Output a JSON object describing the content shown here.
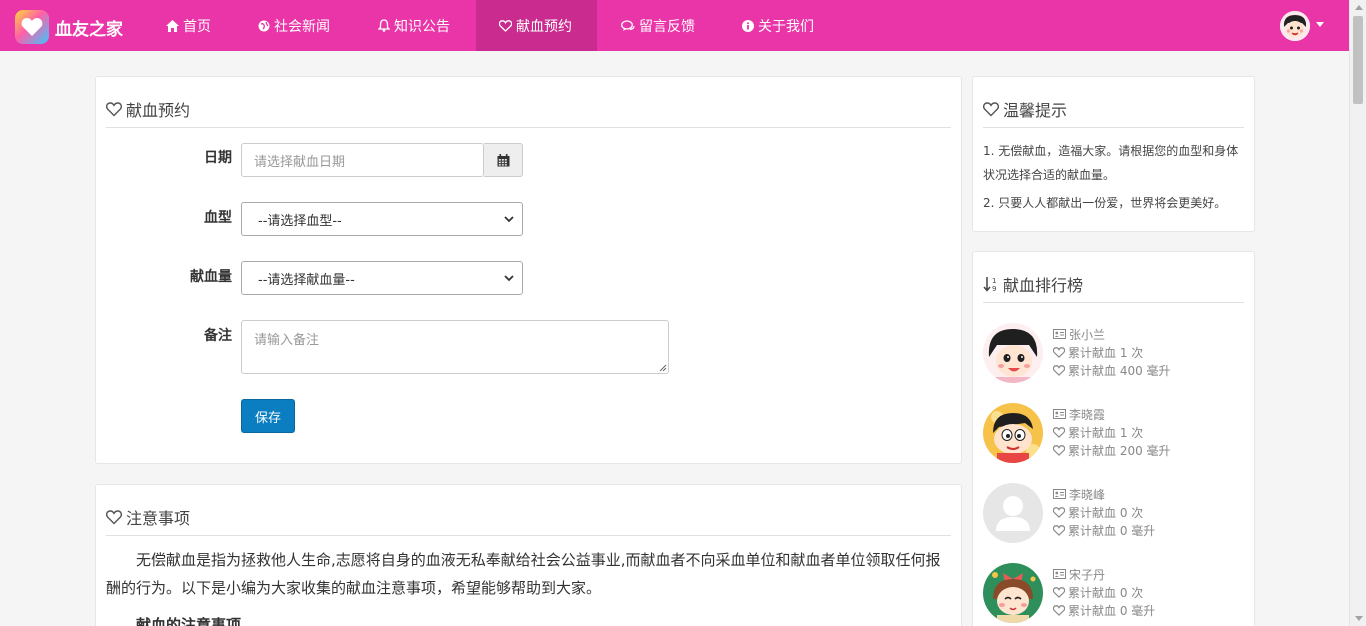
{
  "brand": {
    "name": "血友之家"
  },
  "nav": {
    "items": [
      {
        "label": "首页",
        "icon": "home-icon"
      },
      {
        "label": "社会新闻",
        "icon": "globe-icon"
      },
      {
        "label": "知识公告",
        "icon": "bell-icon"
      },
      {
        "label": "献血预约",
        "icon": "heart-icon",
        "active": true
      },
      {
        "label": "留言反馈",
        "icon": "comments-icon"
      },
      {
        "label": "关于我们",
        "icon": "info-icon"
      }
    ]
  },
  "colors": {
    "navbar": "#e935a8",
    "nav_active": "#c92c8e",
    "primary_button": "#0a7ec0"
  },
  "appointment": {
    "title": "献血预约",
    "date_label": "日期",
    "date_placeholder": "请选择献血日期",
    "blood_type_label": "血型",
    "blood_type_selected": "--请选择血型--",
    "amount_label": "献血量",
    "amount_selected": "--请选择献血量--",
    "remark_label": "备注",
    "remark_placeholder": "请输入备注",
    "save_label": "保存"
  },
  "tips": {
    "title": "温馨提示",
    "items": [
      "1. 无偿献血，造福大家。请根据您的血型和身体状况选择合适的献血量。",
      "2. 只要人人都献出一份爱，世界将会更美好。"
    ]
  },
  "ranking": {
    "title": "献血排行榜",
    "entries": [
      {
        "name": "张小兰",
        "times": "累计献血 1 次",
        "volume": "累计献血 400 毫升",
        "avatar": "cartoon-girl-avatar"
      },
      {
        "name": "李晓霞",
        "times": "累计献血 1 次",
        "volume": "累计献血 200 毫升",
        "avatar": "cartoon-boy-avatar"
      },
      {
        "name": "李晓峰",
        "times": "累计献血 0 次",
        "volume": "累计献血 0 毫升",
        "avatar": "default-user-avatar"
      },
      {
        "name": "宋子丹",
        "times": "累计献血 0 次",
        "volume": "累计献血 0 毫升",
        "avatar": "cartoon-girl-bow-avatar"
      }
    ]
  },
  "notice": {
    "title": "注意事项",
    "paragraph": "无偿献血是指为拯救他人生命,志愿将自身的血液无私奉献给社会公益事业,而献血者不向采血单位和献血者单位领取任何报酬的行为。以下是小编为大家收集的献血注意事项，希望能够帮助到大家。",
    "subheading": "献血的注意事项"
  }
}
